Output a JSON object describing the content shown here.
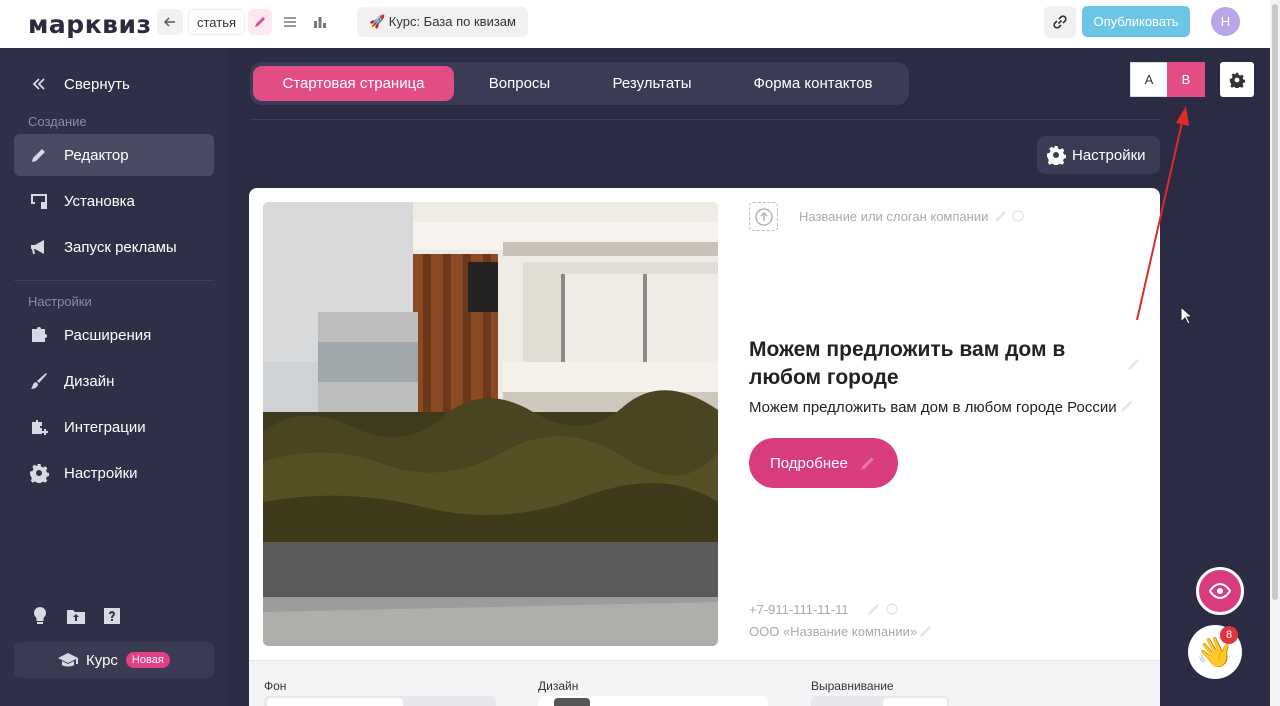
{
  "topbar": {
    "logo": "марквиз",
    "breadcrumb": "статья",
    "course_chip": "🚀 Курс: База по квизам",
    "publish_label": "Опубликовать",
    "avatar_letter": "Н"
  },
  "sidebar": {
    "collapse_label": "Свернуть",
    "section_create": "Создание",
    "section_settings": "Настройки",
    "items": [
      {
        "label": "Редактор",
        "icon": "pencil-icon"
      },
      {
        "label": "Установка",
        "icon": "install-icon"
      },
      {
        "label": "Запуск рекламы",
        "icon": "megaphone-icon"
      },
      {
        "label": "Расширения",
        "icon": "puzzle-icon"
      },
      {
        "label": "Дизайн",
        "icon": "brush-icon"
      },
      {
        "label": "Интеграции",
        "icon": "integration-icon"
      },
      {
        "label": "Настройки",
        "icon": "gear-icon"
      }
    ],
    "course_label": "Курс",
    "course_badge": "Новая"
  },
  "tabs": [
    "Стартовая страница",
    "Вопросы",
    "Результаты",
    "Форма контактов"
  ],
  "ab_test": {
    "a": "A",
    "b": "B"
  },
  "settings_label": "Настройки",
  "card": {
    "slogan_placeholder": "Название или слоган компании",
    "headline": "Можем предложить вам дом в любом городе",
    "subline": "Можем предложить вам дом в любом городе России",
    "cta": "Подробнее",
    "phone": "+7-911-111-11-11",
    "company": "ООО «Название компании»"
  },
  "bottom_panel": {
    "bg_label": "Фон",
    "design_label": "Дизайн",
    "align_label": "Выравнивание"
  },
  "notifications_count": "8",
  "colors": {
    "accent": "#e24d86",
    "sidebar": "#2f3048",
    "publish": "#6cc5e6"
  }
}
